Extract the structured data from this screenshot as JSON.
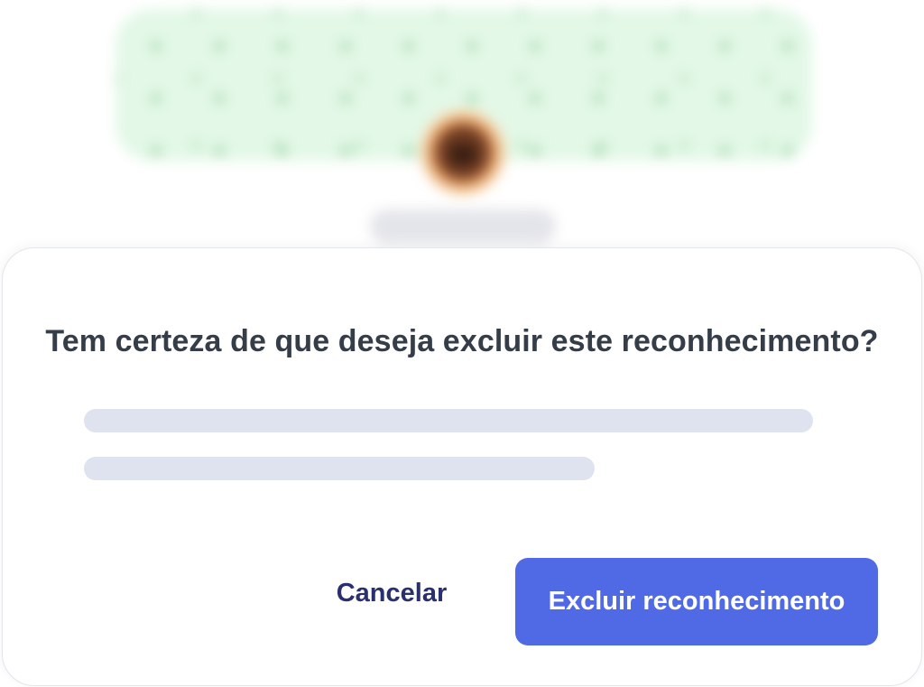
{
  "background_profile": {
    "banner_pattern": "leaf-pattern",
    "avatar_icon": "profile-avatar-icon"
  },
  "dialog": {
    "title": "Tem certeza de que deseja excluir este reconhecimento?",
    "cancel_label": "Cancelar",
    "confirm_label": "Excluir reconhecimento"
  },
  "colors": {
    "banner": "#e3f8e7",
    "primary": "#4f6ae4",
    "cancel_text": "#2a2f6e",
    "skeleton": "#dfe2ef",
    "title_text": "#353d49"
  }
}
